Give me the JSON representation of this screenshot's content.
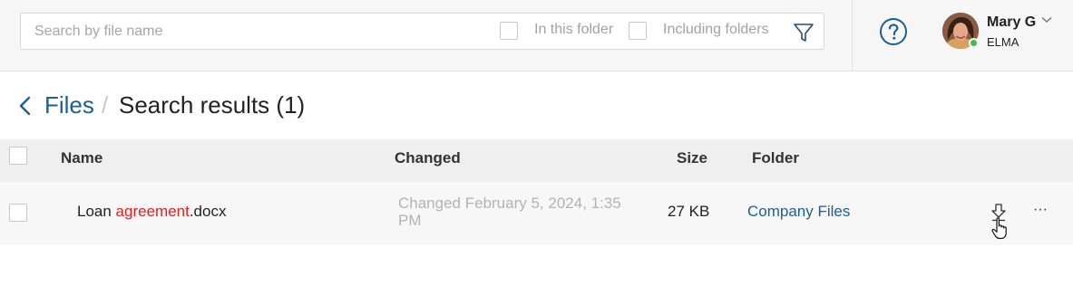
{
  "search": {
    "placeholder": "Search by file name",
    "value": "",
    "option_in_folder": "In this folder",
    "option_including_folders": "Including folders"
  },
  "user": {
    "name": "Mary G",
    "org": "ELMA"
  },
  "breadcrumb": {
    "parent": "Files",
    "separator": "/",
    "title": "Search results (1)"
  },
  "table": {
    "columns": {
      "name": "Name",
      "changed": "Changed",
      "size": "Size",
      "folder": "Folder"
    },
    "rows": [
      {
        "name_prefix": "Loan ",
        "name_highlight": "agreement",
        "name_suffix": ".docx",
        "changed": "Changed February 5, 2024, 1:35 PM",
        "size": "27 KB",
        "folder": "Company Files",
        "more": "···"
      }
    ]
  },
  "colors": {
    "accent": "#1d5f92",
    "highlight": "#e02020",
    "status_online": "#3dbb55"
  },
  "icons": [
    "filter-icon",
    "help-icon",
    "chevron-down-icon",
    "back-arrow-icon",
    "download-icon",
    "more-icon",
    "hand-cursor-icon"
  ]
}
